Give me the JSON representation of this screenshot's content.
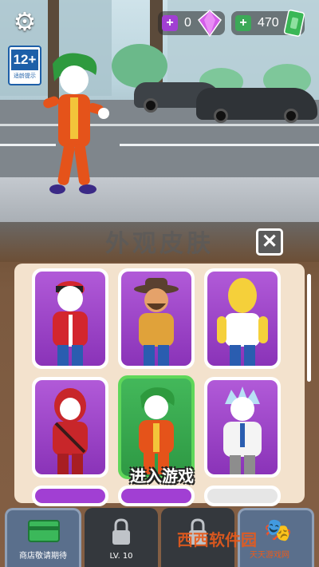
{
  "hud": {
    "settings_icon": "gear-icon",
    "age_rating": "12+",
    "age_rating_org": "CADPA",
    "age_rating_label": "适龄提示",
    "gems": "0",
    "cash": "470",
    "plus_symbol": "+"
  },
  "panel": {
    "title": "外观皮肤",
    "close_symbol": "✕",
    "enter_game": "进入游戏"
  },
  "skins": [
    {
      "name": "red-cap-skin",
      "selected": false
    },
    {
      "name": "cowboy-hat-skin",
      "selected": false
    },
    {
      "name": "yellow-hair-skin",
      "selected": false
    },
    {
      "name": "red-hood-skin",
      "selected": false
    },
    {
      "name": "joker-skin",
      "selected": true
    },
    {
      "name": "scientist-skin",
      "selected": false
    }
  ],
  "nav": {
    "shop_label": "商店敬请期待",
    "level_label": "LV. 10",
    "locked2_label": "",
    "skins_label": ""
  },
  "watermark": {
    "brand": "西西软件园",
    "site": "天天游戏网"
  },
  "colors": {
    "selected_card": "#5fd75a",
    "card_purple": "#a13fd3",
    "gem": "#a13fd3",
    "cash": "#3ca958",
    "panel": "#7b5a40"
  }
}
